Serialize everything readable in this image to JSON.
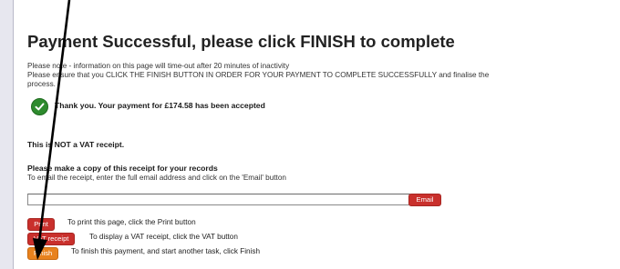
{
  "page": {
    "title": "Payment Successful, please click FINISH to complete",
    "notice": [
      "Please note - information on this page will time-out after 20 minutes of inactivity",
      "Please ensure that you CLICK THE FINISH BUTTON IN ORDER FOR YOUR PAYMENT TO COMPLETE SUCCESSFULLY and finalise the",
      "process."
    ]
  },
  "confirmation": {
    "icon": "check-icon",
    "message": "Thank you. Your payment for £174.58 has been accepted"
  },
  "vat_note": "This is NOT a VAT receipt.",
  "receipt": {
    "heading": "Please make a copy of this receipt for your records",
    "email_instructions": "To email the receipt, enter the full email address and click on the 'Email' button",
    "email_value": "",
    "email_button_label": "Email"
  },
  "actions": {
    "print": {
      "label": "Print",
      "description": "To print this page, click the Print button"
    },
    "vat": {
      "label": "VAT receipt",
      "description": "To display a VAT receipt, click the VAT button"
    },
    "finish": {
      "label": "Finish",
      "description": "To finish this payment, and start another task, click Finish"
    }
  },
  "colors": {
    "button_red": "#c9302c",
    "button_orange": "#e8821e",
    "success_green": "#2e8b2e",
    "arrow": "#000000"
  }
}
